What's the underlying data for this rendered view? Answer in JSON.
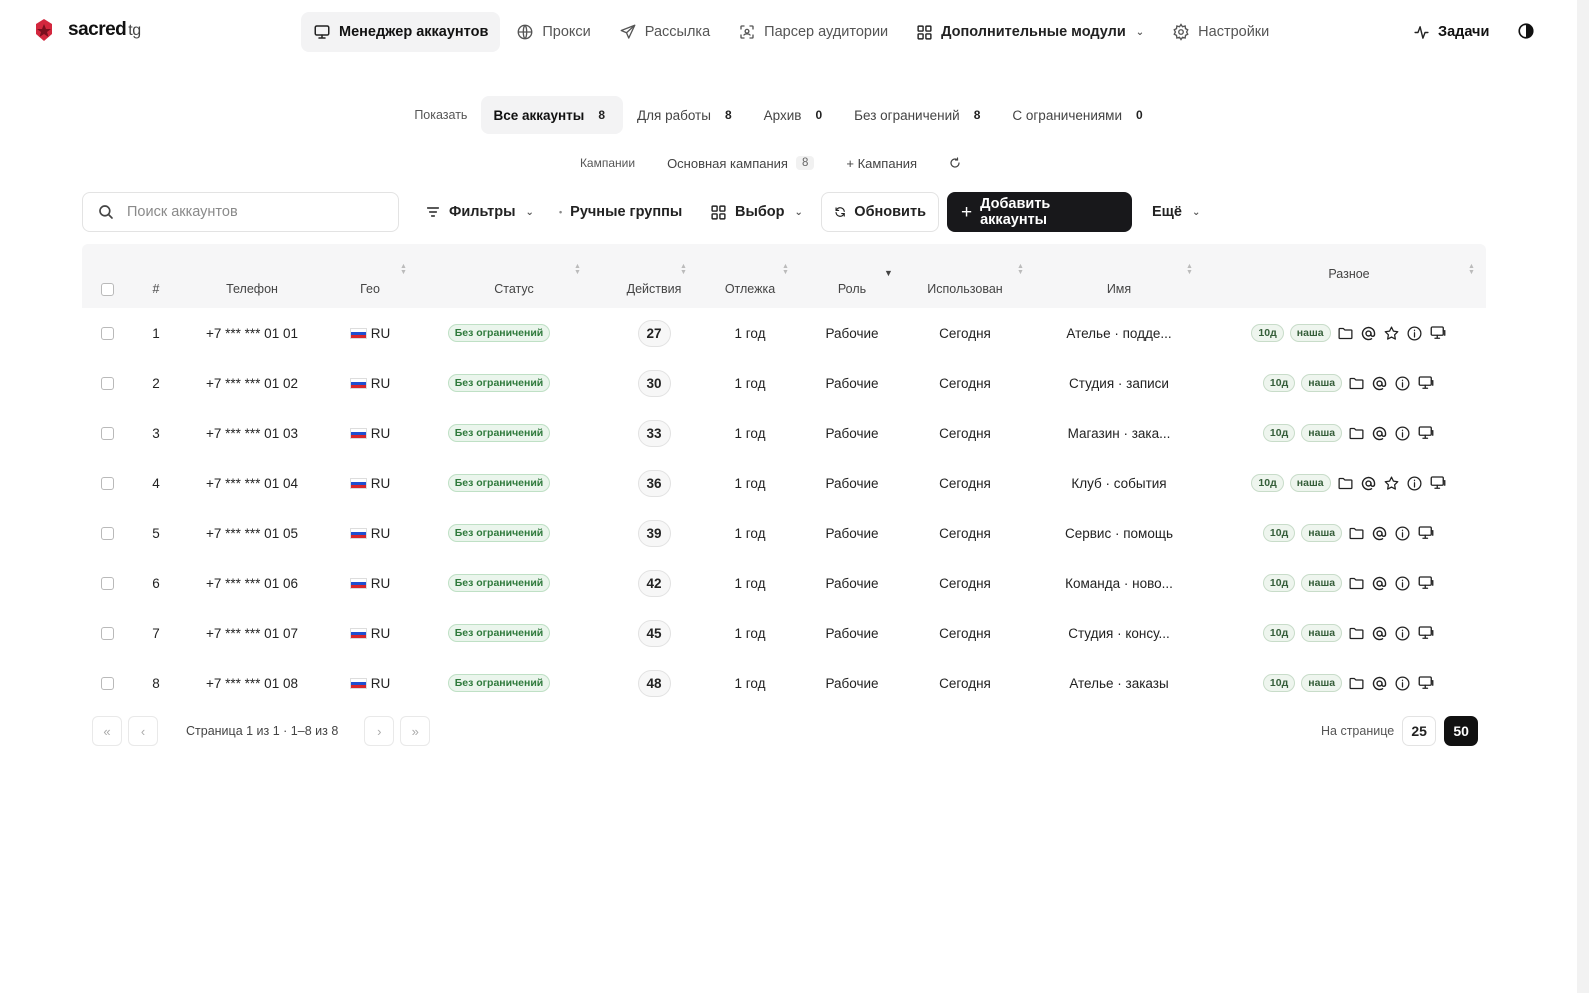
{
  "app": {
    "logo_text": "sacred",
    "logo_suffix": "tg"
  },
  "nav": {
    "items": [
      {
        "label": "Менеджер аккаунтов",
        "icon": "monitor-icon",
        "active": true
      },
      {
        "label": "Прокси",
        "icon": "globe-icon"
      },
      {
        "label": "Рассылка",
        "icon": "send-icon"
      },
      {
        "label": "Парсер аудитории",
        "icon": "scan-icon"
      },
      {
        "label": "Дополнительные модули",
        "icon": "grid-icon",
        "dropdown": true
      },
      {
        "label": "Настройки",
        "icon": "gear-icon"
      }
    ],
    "tasks_label": "Задачи"
  },
  "tabs": {
    "show_label": "Показать",
    "items": [
      {
        "label": "Все аккаунты",
        "count": "8",
        "active": true
      },
      {
        "label": "Для работы",
        "count": "8"
      },
      {
        "label": "Архив",
        "count": "0"
      },
      {
        "label": "Без ограничений",
        "count": "8"
      },
      {
        "label": "С ограничениями",
        "count": "0"
      }
    ]
  },
  "campaigns": {
    "label": "Кампании",
    "main_label": "Основная кампания",
    "main_count": "8",
    "add_label": "+ Кампания"
  },
  "toolbar": {
    "search_placeholder": "Поиск аккаунтов",
    "filters_label": "Фильтры",
    "groups_label": "Ручные группы",
    "select_label": "Выбор",
    "refresh_label": "Обновить",
    "add_label": "Добавить аккаунты",
    "more_label": "Ещё"
  },
  "table": {
    "columns": {
      "num": "#",
      "phone": "Телефон",
      "geo": "Гео",
      "status": "Статус",
      "actions": "Действия",
      "age": "Отлежка",
      "role": "Роль",
      "used": "Использован",
      "name": "Имя",
      "misc": "Разное"
    },
    "rows": [
      {
        "num": "1",
        "phone": "+7 *** *** 01 01",
        "geo": "RU",
        "status": "Без ограничений",
        "actions": "27",
        "age": "1 год",
        "role": "Рабочие",
        "used": "Сегодня",
        "name": "Ателье · подде...",
        "tag1": "10д",
        "tag2": "наша",
        "star": true
      },
      {
        "num": "2",
        "phone": "+7 *** *** 01 02",
        "geo": "RU",
        "status": "Без ограничений",
        "actions": "30",
        "age": "1 год",
        "role": "Рабочие",
        "used": "Сегодня",
        "name": "Студия · записи",
        "tag1": "10д",
        "tag2": "наша",
        "star": false
      },
      {
        "num": "3",
        "phone": "+7 *** *** 01 03",
        "geo": "RU",
        "status": "Без ограничений",
        "actions": "33",
        "age": "1 год",
        "role": "Рабочие",
        "used": "Сегодня",
        "name": "Магазин · зака...",
        "tag1": "10д",
        "tag2": "наша",
        "star": false
      },
      {
        "num": "4",
        "phone": "+7 *** *** 01 04",
        "geo": "RU",
        "status": "Без ограничений",
        "actions": "36",
        "age": "1 год",
        "role": "Рабочие",
        "used": "Сегодня",
        "name": "Клуб · события",
        "tag1": "10д",
        "tag2": "наша",
        "star": true
      },
      {
        "num": "5",
        "phone": "+7 *** *** 01 05",
        "geo": "RU",
        "status": "Без ограничений",
        "actions": "39",
        "age": "1 год",
        "role": "Рабочие",
        "used": "Сегодня",
        "name": "Сервис · помощь",
        "tag1": "10д",
        "tag2": "наша",
        "star": false
      },
      {
        "num": "6",
        "phone": "+7 *** *** 01 06",
        "geo": "RU",
        "status": "Без ограничений",
        "actions": "42",
        "age": "1 год",
        "role": "Рабочие",
        "used": "Сегодня",
        "name": "Команда · ново...",
        "tag1": "10д",
        "tag2": "наша",
        "star": false
      },
      {
        "num": "7",
        "phone": "+7 *** *** 01 07",
        "geo": "RU",
        "status": "Без ограничений",
        "actions": "45",
        "age": "1 год",
        "role": "Рабочие",
        "used": "Сегодня",
        "name": "Студия · консу...",
        "tag1": "10д",
        "tag2": "наша",
        "star": false
      },
      {
        "num": "8",
        "phone": "+7 *** *** 01 08",
        "geo": "RU",
        "status": "Без ограничений",
        "actions": "48",
        "age": "1 год",
        "role": "Рабочие",
        "used": "Сегодня",
        "name": "Ателье · заказы",
        "tag1": "10д",
        "tag2": "наша",
        "star": false
      }
    ]
  },
  "pagination": {
    "first": "«",
    "prev": "‹",
    "next": "›",
    "last": "»",
    "info": "Страница 1 из 1 · 1–8 из 8",
    "per_page_label": "На странице",
    "sizes": [
      "25",
      "50"
    ],
    "active_size": "50"
  },
  "colors": {
    "accent_dark": "#18181b",
    "status_green": "#2f7a3c",
    "logo_red": "#d3273e"
  }
}
